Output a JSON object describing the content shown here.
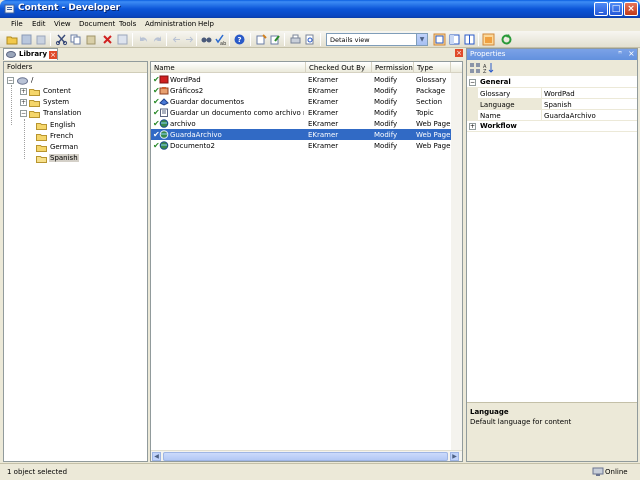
{
  "window": {
    "title": "Content - Developer",
    "min_glyph": "_",
    "max_glyph": "□",
    "close_glyph": "×"
  },
  "menu": [
    {
      "label": "File"
    },
    {
      "label": "Edit"
    },
    {
      "label": "View"
    },
    {
      "label": "Document"
    },
    {
      "label": "Tools"
    },
    {
      "label": "Administration"
    },
    {
      "label": "Help"
    }
  ],
  "toolbar": {
    "view_select": {
      "value": "Details view",
      "drop_glyph": "▼"
    },
    "icons": [
      "open-icon",
      "save-icon",
      "save-all-icon",
      "cut-icon",
      "copy-icon",
      "paste-icon",
      "delete-icon",
      "properties-icon",
      "undo-icon",
      "redo-icon",
      "back-icon",
      "forward-icon",
      "find-icon",
      "spellcheck-icon",
      "help-icon",
      "check-out-icon",
      "check-in-icon",
      "print-icon",
      "preview-icon",
      "details-view-icon",
      "list-view-icon",
      "split-view-icon",
      "publish-icon",
      "refresh-icon"
    ]
  },
  "library_tab": {
    "label": "Library",
    "close_glyph": "×"
  },
  "folders": {
    "header": "Folders",
    "tree": [
      {
        "label": "/",
        "level": 0,
        "expander": "−",
        "icon": "server-icon"
      },
      {
        "label": "Content",
        "level": 1,
        "expander": "+",
        "icon": "folder-icon"
      },
      {
        "label": "System",
        "level": 1,
        "expander": "+",
        "icon": "folder-icon"
      },
      {
        "label": "Translation",
        "level": 1,
        "expander": "−",
        "icon": "folder-icon"
      },
      {
        "label": "English",
        "level": 2,
        "expander": "",
        "icon": "folder-icon"
      },
      {
        "label": "French",
        "level": 2,
        "expander": "",
        "icon": "folder-icon"
      },
      {
        "label": "German",
        "level": 2,
        "expander": "",
        "icon": "folder-icon"
      },
      {
        "label": "Spanish",
        "level": 2,
        "expander": "",
        "icon": "folder-open-icon",
        "selected": true
      }
    ]
  },
  "documents": {
    "columns": [
      "Name",
      "Checked Out By",
      "Permission",
      "Type"
    ],
    "rows": [
      {
        "name": "WordPad",
        "checked_out_by": "EKramer",
        "permission": "Modify",
        "type": "Glossary",
        "icon": "glossary-icon"
      },
      {
        "name": "Gráficos2",
        "checked_out_by": "EKramer",
        "permission": "Modify",
        "type": "Package",
        "icon": "package-icon"
      },
      {
        "name": "Guardar documentos",
        "checked_out_by": "EKramer",
        "permission": "Modify",
        "type": "Section",
        "icon": "section-icon"
      },
      {
        "name": "Guardar un documento como archivo nuevo",
        "checked_out_by": "EKramer",
        "permission": "Modify",
        "type": "Topic",
        "icon": "topic-icon"
      },
      {
        "name": "archivo",
        "checked_out_by": "EKramer",
        "permission": "Modify",
        "type": "Web Page",
        "icon": "webpage-icon"
      },
      {
        "name": "GuardaArchivo",
        "checked_out_by": "EKramer",
        "permission": "Modify",
        "type": "Web Page",
        "icon": "webpage-icon",
        "selected": true
      },
      {
        "name": "Documento2",
        "checked_out_by": "EKramer",
        "permission": "Modify",
        "type": "Web Page",
        "icon": "webpage-icon"
      }
    ],
    "checked_out_glyph": "✔"
  },
  "properties": {
    "title": "Properties",
    "pin_glyph": "ꟸ",
    "close_glyph": "×",
    "categories": [
      {
        "label": "General",
        "expander": "−"
      },
      {
        "label": "Workflow",
        "expander": "+"
      }
    ],
    "rows": [
      {
        "name": "Glossary",
        "value": "WordPad"
      },
      {
        "name": "Language",
        "value": "Spanish",
        "selected": true
      },
      {
        "name": "Name",
        "value": "GuardaArchivo"
      }
    ],
    "description_title": "Language",
    "description_text": "Default language for content"
  },
  "status": {
    "message": "1 object selected",
    "connection": "Online"
  }
}
